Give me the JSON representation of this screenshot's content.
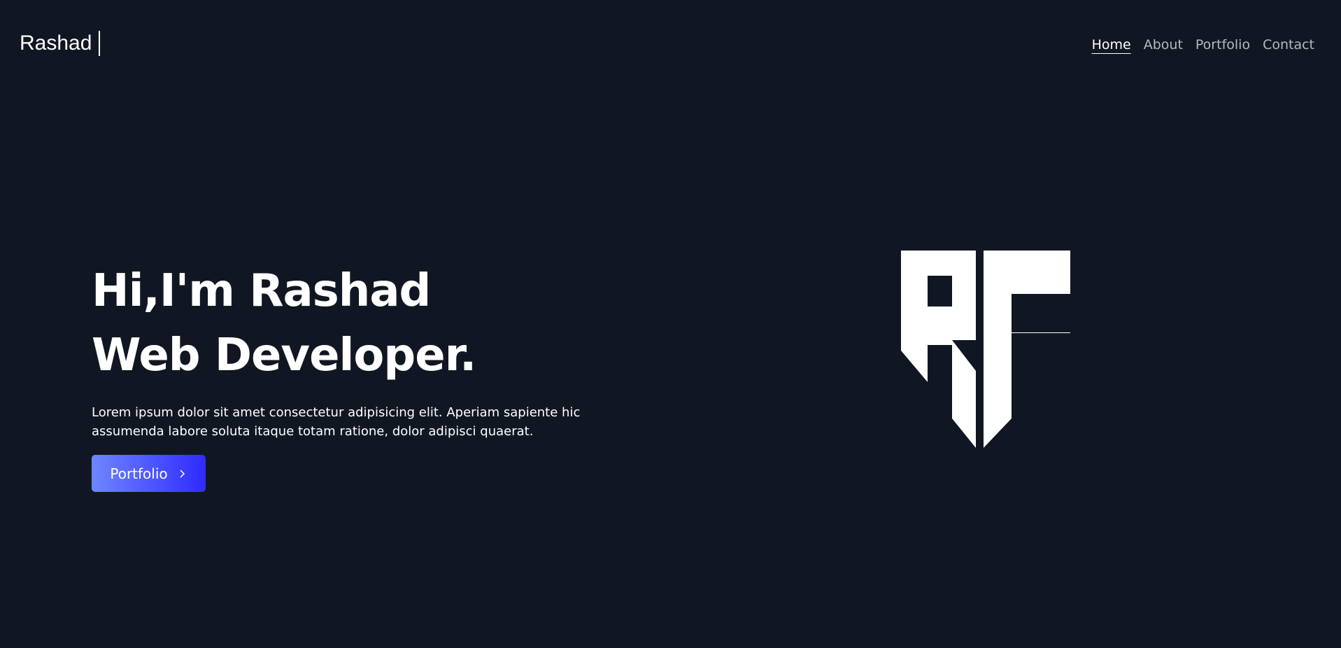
{
  "header": {
    "brand": "Rashad",
    "nav": [
      {
        "label": "Home",
        "active": true
      },
      {
        "label": "About",
        "active": false
      },
      {
        "label": "Portfolio",
        "active": false
      },
      {
        "label": "Contact",
        "active": false
      }
    ]
  },
  "hero": {
    "title_line1": "Hi,I'm Rashad",
    "title_line2": "Web Developer.",
    "description": "Lorem ipsum dolor sit amet consectetur adipisicing elit. Aperiam sapiente hic assumenda labore soluta itaque totam ratione, dolor adipisci quaerat.",
    "cta_label": "Portfolio",
    "cta_icon": "chevron-right-icon"
  },
  "logo": {
    "text": "RF"
  },
  "colors": {
    "background": "#111722",
    "text": "#ffffff",
    "nav_inactive": "#b5b9c1",
    "button_gradient_start": "#6e86ff",
    "button_gradient_end": "#2f2bff"
  }
}
